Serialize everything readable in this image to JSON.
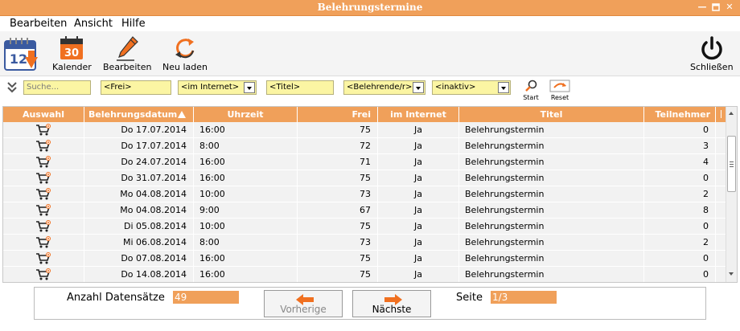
{
  "window": {
    "title": "Belehrungstermine"
  },
  "menu": [
    "Bearbeiten",
    "Ansicht",
    "Hilfe"
  ],
  "toolbar": {
    "kalender": "Kalender",
    "kalender_day": "30",
    "app_day": "12",
    "bearbeiten": "Bearbeiten",
    "neu_laden": "Neu laden",
    "schliessen": "Schließen"
  },
  "filters": {
    "search_placeholder": "Suche...",
    "frei": "<Frei>",
    "internet": "<im Internet>",
    "titel": "<Titel>",
    "belehrende": "<Belehrende/r>",
    "inaktiv": "<inaktiv>",
    "start": "Start",
    "reset": "Reset"
  },
  "table": {
    "columns": [
      "Auswahl",
      "Belehrungsdatum",
      "Uhrzeit",
      "Frei",
      "im Internet",
      "Titel",
      "Teilnehmer"
    ],
    "rows": [
      {
        "datum": "Do 17.07.2014",
        "uhrzeit": "16:00",
        "frei": "75",
        "internet": "Ja",
        "titel": "Belehrungstermin",
        "teilnehmer": "0"
      },
      {
        "datum": "Do 17.07.2014",
        "uhrzeit": "8:00",
        "frei": "72",
        "internet": "Ja",
        "titel": "Belehrungstermin",
        "teilnehmer": "3"
      },
      {
        "datum": "Do 24.07.2014",
        "uhrzeit": "16:00",
        "frei": "71",
        "internet": "Ja",
        "titel": "Belehrungstermin",
        "teilnehmer": "4"
      },
      {
        "datum": "Do 31.07.2014",
        "uhrzeit": "16:00",
        "frei": "75",
        "internet": "Ja",
        "titel": "Belehrungstermin",
        "teilnehmer": "0"
      },
      {
        "datum": "Mo 04.08.2014",
        "uhrzeit": "10:00",
        "frei": "73",
        "internet": "Ja",
        "titel": "Belehrungstermin",
        "teilnehmer": "2"
      },
      {
        "datum": "Mo 04.08.2014",
        "uhrzeit": "9:00",
        "frei": "67",
        "internet": "Ja",
        "titel": "Belehrungstermin",
        "teilnehmer": "8"
      },
      {
        "datum": "Di 05.08.2014",
        "uhrzeit": "10:00",
        "frei": "75",
        "internet": "Ja",
        "titel": "Belehrungstermin",
        "teilnehmer": "0"
      },
      {
        "datum": "Mi 06.08.2014",
        "uhrzeit": "8:00",
        "frei": "73",
        "internet": "Ja",
        "titel": "Belehrungstermin",
        "teilnehmer": "2"
      },
      {
        "datum": "Do 07.08.2014",
        "uhrzeit": "16:00",
        "frei": "75",
        "internet": "Ja",
        "titel": "Belehrungstermin",
        "teilnehmer": "0"
      },
      {
        "datum": "Do 14.08.2014",
        "uhrzeit": "16:00",
        "frei": "75",
        "internet": "Ja",
        "titel": "Belehrungstermin",
        "teilnehmer": "0"
      }
    ]
  },
  "footer": {
    "anzahl_label": "Anzahl Datensätze",
    "anzahl_value": "49",
    "prev": "Vorherige",
    "next": "Nächste",
    "seite_label": "Seite",
    "seite_value": "1/3"
  },
  "colors": {
    "accent": "#f0a05a",
    "filter_bg": "#fbf5a3",
    "row_bg": "#f2f2f2"
  }
}
